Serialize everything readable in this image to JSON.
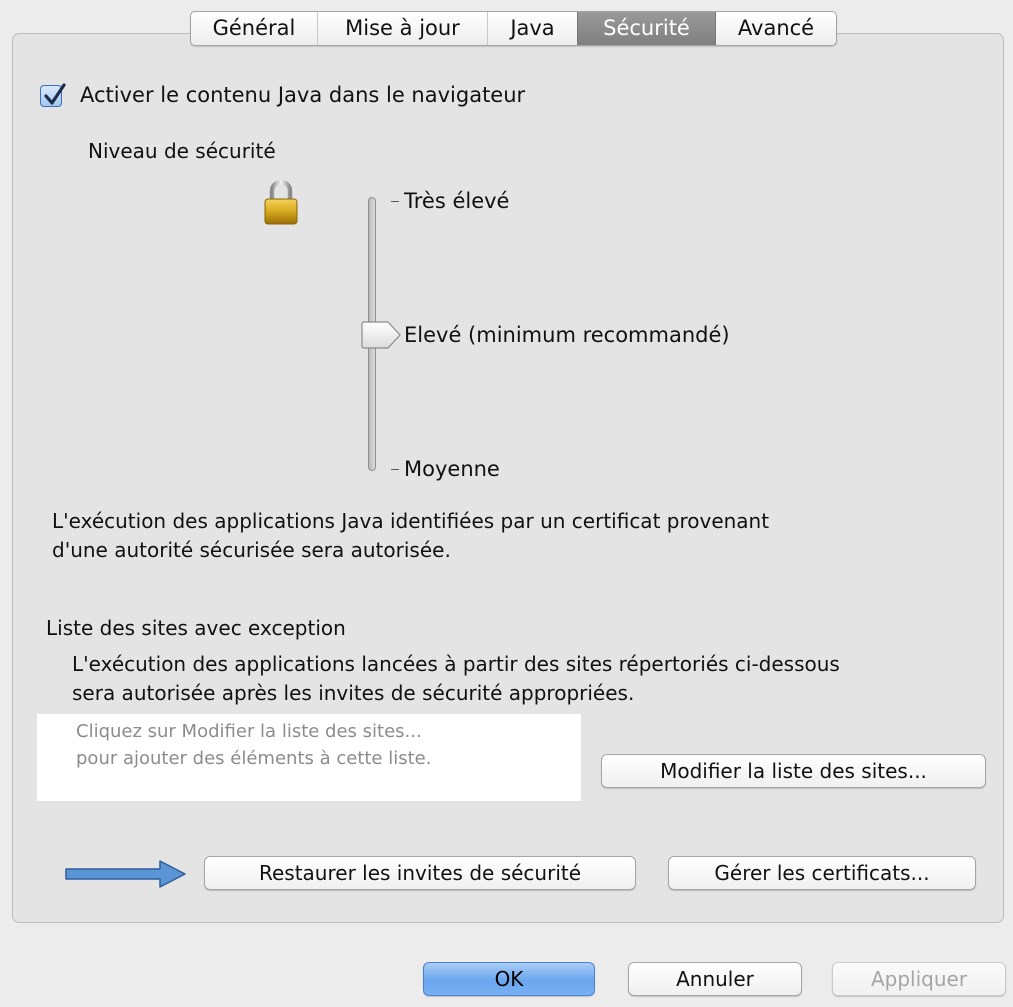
{
  "tabs": [
    {
      "label": "Général",
      "active": false
    },
    {
      "label": "Mise à jour",
      "active": false
    },
    {
      "label": "Java",
      "active": false
    },
    {
      "label": "Sécurité",
      "active": true
    },
    {
      "label": "Avancé",
      "active": false
    }
  ],
  "enable_java": {
    "checked": true,
    "label": "Activer le contenu Java dans le navigateur"
  },
  "security_level": {
    "heading": "Niveau de sécurité",
    "icon": "padlock-icon",
    "levels": [
      "Très élevé",
      "Elevé (minimum recommandé)",
      "Moyenne"
    ],
    "selected": "Elevé (minimum recommandé)",
    "description_line1": "L'exécution des applications Java identifiées par un certificat provenant",
    "description_line2": "d'une autorité sécurisée sera autorisée."
  },
  "exception_sites": {
    "heading": "Liste des sites avec exception",
    "description_line1": "L'exécution des applications lancées à partir des sites répertoriés ci-dessous",
    "description_line2": "sera autorisée après les invites de sécurité appropriées.",
    "empty_hint_line1": "Cliquez sur Modifier la liste des sites...",
    "empty_hint_line2": "pour ajouter des éléments à cette liste.",
    "edit_button": "Modifier la liste des sites..."
  },
  "actions": {
    "restore_prompts": "Restaurer les invites de sécurité",
    "manage_certificates": "Gérer les certificats...",
    "annotation_arrow_color": "#4a86c8"
  },
  "footer": {
    "ok": "OK",
    "cancel": "Annuler",
    "apply": "Appliquer",
    "apply_enabled": false
  },
  "colors": {
    "accent": "#6aa5ee",
    "tab_active": "#8a8a8a",
    "window_bg": "#ececec"
  }
}
